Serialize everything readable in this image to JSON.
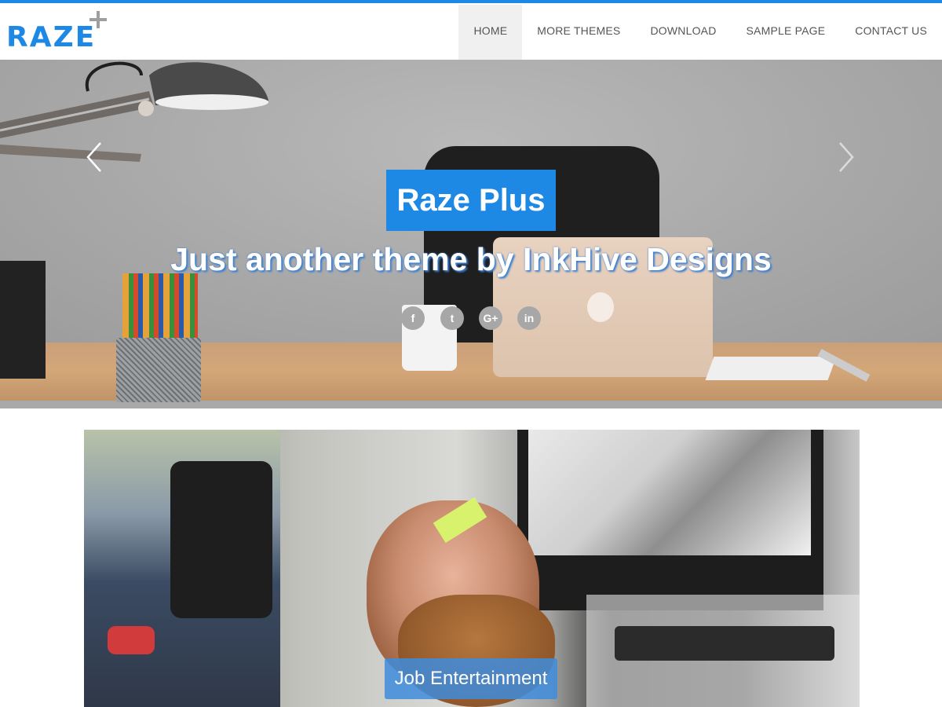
{
  "site": {
    "logo_text": "RAZE",
    "accent_color": "#1e88e5"
  },
  "nav": {
    "items": [
      {
        "label": "HOME",
        "active": true
      },
      {
        "label": "MORE THEMES",
        "active": false
      },
      {
        "label": "DOWNLOAD",
        "active": false
      },
      {
        "label": "SAMPLE PAGE",
        "active": false
      },
      {
        "label": "CONTACT US",
        "active": false
      }
    ]
  },
  "hero": {
    "title": "Raze Plus",
    "subtitle": "Just another theme by InkHive Designs",
    "social": [
      {
        "icon": "facebook-icon",
        "glyph": "f"
      },
      {
        "icon": "twitter-icon",
        "glyph": "t"
      },
      {
        "icon": "google-plus-icon",
        "glyph": "G+"
      },
      {
        "icon": "linkedin-icon",
        "glyph": "in"
      }
    ]
  },
  "slider": {
    "caption": "Job Entertainment"
  }
}
